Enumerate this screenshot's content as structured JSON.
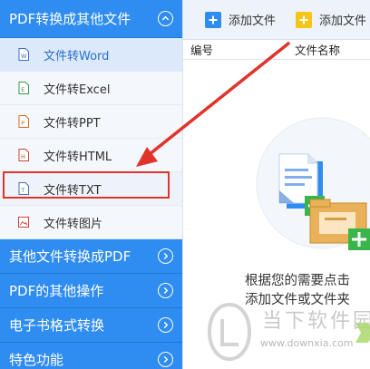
{
  "sidebar": {
    "groups": [
      {
        "label": "PDF转换成其他文件"
      },
      {
        "label": "其他文件转换成PDF"
      },
      {
        "label": "PDF的其他操作"
      },
      {
        "label": "电子书格式转换"
      },
      {
        "label": "特色功能"
      }
    ],
    "items": [
      {
        "label": "文件转Word"
      },
      {
        "label": "文件转Excel"
      },
      {
        "label": "文件转PPT"
      },
      {
        "label": "文件转HTML"
      },
      {
        "label": "文件转TXT"
      },
      {
        "label": "文件转图片"
      }
    ]
  },
  "toolbar": {
    "add_file_label": "添加文件",
    "add_folder_label": "添加文件"
  },
  "table": {
    "columns": [
      "编号",
      "文件名称"
    ]
  },
  "empty_state": {
    "line1": "根据您的需要点击",
    "line2": "添加文件或文件夹"
  },
  "watermark": {
    "text": "当下软件园",
    "url": "www.downxia.com"
  },
  "colors": {
    "sidebar_header": "#2f8cf0",
    "selected_bg": "#dbe9fb",
    "highlight_red": "#e0342a",
    "add_file_icon": "#2f8cf0",
    "add_folder_icon": "#f5c518"
  }
}
